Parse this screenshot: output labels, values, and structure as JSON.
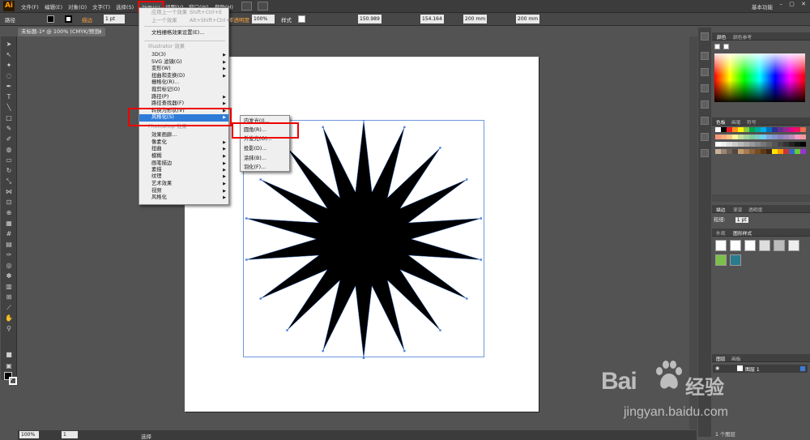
{
  "app": {
    "logo": "Ai",
    "workspace": "基本功能",
    "window_controls": "–  ▢  ✕"
  },
  "menubar": {
    "items": [
      "文件(F)",
      "编辑(E)",
      "对象(O)",
      "文字(T)",
      "选择(S)",
      "效果(C)",
      "视图(V)",
      "窗口(W)",
      "帮助(H)"
    ],
    "active": "效果(C)"
  },
  "control": {
    "path_label": "路径",
    "stroke_label": "描边",
    "stroke_value": "1 pt",
    "opacity_label": "不透明度",
    "opacity_value": "100%",
    "style_label": "样式",
    "x_value": "150.989",
    "y_value": "154.164",
    "w_value": "200 mm",
    "h_value": "200 mm"
  },
  "document_tab": {
    "title": "未标题-1* @ 100% (CMYK/预览)",
    "close": "×"
  },
  "effect_menu": {
    "items": [
      {
        "label": "应用上一个效果",
        "shortcut": "Shift+Ctrl+E",
        "disabled": true
      },
      {
        "label": "上一个效果",
        "shortcut": "Alt+Shift+Ctrl+E",
        "disabled": true
      },
      {
        "label": "文档栅格效果设置(E)...",
        "shortcut": ""
      },
      {
        "label": "Illustrator 效果",
        "section": true
      },
      {
        "label": "3D(3)",
        "arrow": true
      },
      {
        "label": "SVG 滤镜(G)",
        "arrow": true
      },
      {
        "label": "变形(W)",
        "arrow": true
      },
      {
        "label": "扭曲和变换(D)",
        "arrow": true
      },
      {
        "label": "栅格化(R)...",
        "arrow": false
      },
      {
        "label": "裁剪标记(O)",
        "arrow": false
      },
      {
        "label": "路径(P)",
        "arrow": true
      },
      {
        "label": "路径查找器(F)",
        "arrow": true
      },
      {
        "label": "转换为形状(V)",
        "arrow": true
      },
      {
        "label": "风格化(S)",
        "arrow": true,
        "highlighted": true
      },
      {
        "label": "Photoshop 效果",
        "section": true
      },
      {
        "label": "效果画廊...",
        "arrow": false
      },
      {
        "label": "像素化",
        "arrow": true
      },
      {
        "label": "扭曲",
        "arrow": true
      },
      {
        "label": "模糊",
        "arrow": true
      },
      {
        "label": "画笔描边",
        "arrow": true
      },
      {
        "label": "素描",
        "arrow": true
      },
      {
        "label": "纹理",
        "arrow": true
      },
      {
        "label": "艺术效果",
        "arrow": true
      },
      {
        "label": "视频",
        "arrow": true
      },
      {
        "label": "风格化",
        "arrow": true
      }
    ]
  },
  "stylize_submenu": {
    "items": [
      "内发光(I)...",
      "圆角(R)...",
      "外发光(O)...",
      "投影(D)...",
      "涂抹(B)...",
      "羽化(F)..."
    ],
    "selected": "圆角(R)..."
  },
  "panels": {
    "color_tabs": [
      "颜色",
      "颜色参考"
    ],
    "swatch_tabs": [
      "色板",
      "画笔",
      "符号"
    ],
    "stroke_tabs": [
      "描边",
      "渐变",
      "透明度"
    ],
    "stroke_label": "粗细:",
    "stroke_weight": "1 pt",
    "style_tabs": [
      "外观",
      "图形样式"
    ],
    "layers_tabs": [
      "图层",
      "画板"
    ],
    "layer_name": "图层 1",
    "layer_count": "1 个图层"
  },
  "status": {
    "zoom": "100%",
    "page": "1",
    "tool": "选择"
  },
  "watermark": {
    "brand": "Bai",
    "brand_suffix": "经验",
    "url": "jingyan.baidu.com"
  },
  "star": {
    "points": 18,
    "fill": "#000000",
    "outer_ratio": 1.0,
    "inner_ratio": 0.4
  },
  "colors": {
    "highlight": "#2f7bd8",
    "annotation": "#e00000",
    "selection": "#4a7fd6"
  }
}
